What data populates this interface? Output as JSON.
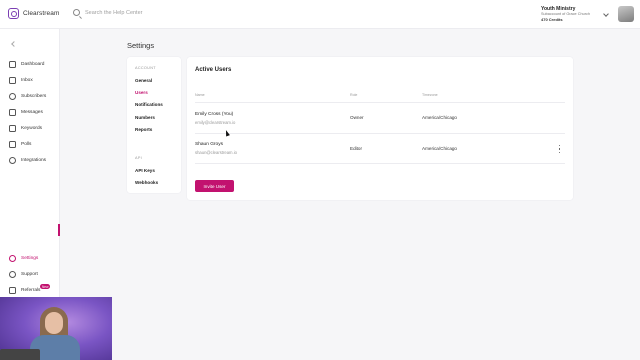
{
  "app": {
    "logo_text": "Clearstream",
    "search_placeholder": "Search the Help Center"
  },
  "org": {
    "name": "Youth Ministry",
    "subtitle": "Subaccount of Grace Church",
    "credits": "470 Credits"
  },
  "sidebar": {
    "items": [
      {
        "label": "Dashboard",
        "icon": "dashboard-icon"
      },
      {
        "label": "Inbox",
        "icon": "inbox-icon"
      },
      {
        "label": "Subscribers",
        "icon": "subscribers-icon"
      },
      {
        "label": "Messages",
        "icon": "messages-icon"
      },
      {
        "label": "Keywords",
        "icon": "keywords-icon"
      },
      {
        "label": "Polls",
        "icon": "polls-icon"
      },
      {
        "label": "Integrations",
        "icon": "integrations-icon"
      }
    ],
    "bottom_items": [
      {
        "label": "Settings",
        "icon": "settings-icon",
        "active": true
      },
      {
        "label": "Support",
        "icon": "support-icon"
      },
      {
        "label": "Referrals",
        "icon": "referrals-icon"
      }
    ],
    "referrals_badge": "New"
  },
  "page": {
    "title": "Settings"
  },
  "settings_menu": {
    "account_heading": "ACCOUNT",
    "account_items": [
      "General",
      "Users",
      "Notifications",
      "Numbers",
      "Reports"
    ],
    "active_item": "Users",
    "api_heading": "API",
    "api_items": [
      "API Keys",
      "Webhooks"
    ]
  },
  "users_panel": {
    "title": "Active Users",
    "columns": [
      "Name",
      "Role",
      "Timezone"
    ],
    "rows": [
      {
        "name": "Emily Cross (You)",
        "email": "emily@clearstream.io",
        "role": "Owner",
        "timezone": "America/Chicago"
      },
      {
        "name": "Shaun Groys",
        "email": "shaun@clearstream.io",
        "role": "Editor",
        "timezone": "America/Chicago"
      }
    ],
    "invite_label": "Invite User"
  },
  "colors": {
    "accent": "#c2126f",
    "brand": "#7b3fb3"
  }
}
